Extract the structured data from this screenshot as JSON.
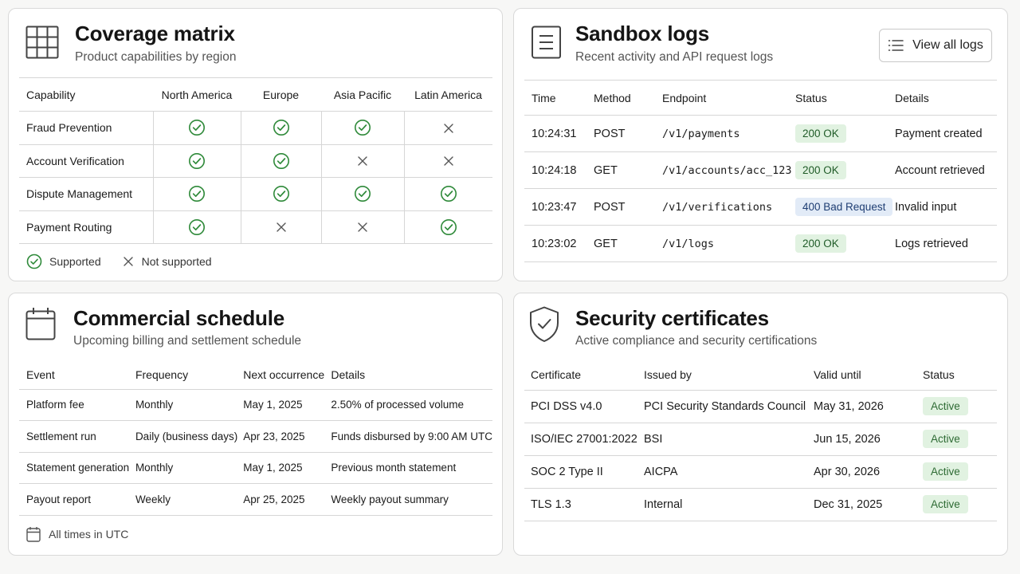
{
  "coverage": {
    "title": "Coverage matrix",
    "subtitle": "Product capabilities by region",
    "columns": [
      "Capability",
      "North America",
      "Europe",
      "Asia Pacific",
      "Latin America"
    ],
    "rows": [
      {
        "capability": "Fraud Prevention",
        "support": [
          true,
          true,
          true,
          false
        ]
      },
      {
        "capability": "Account Verification",
        "support": [
          true,
          true,
          false,
          false
        ]
      },
      {
        "capability": "Dispute Management",
        "support": [
          true,
          true,
          true,
          true
        ]
      },
      {
        "capability": "Payment Routing",
        "support": [
          true,
          false,
          false,
          true
        ]
      }
    ],
    "legend": {
      "supported": "Supported",
      "not_supported": "Not supported"
    }
  },
  "logs": {
    "title": "Sandbox logs",
    "subtitle": "Recent activity and API request logs",
    "view_all_label": "View all logs",
    "columns": [
      "Time",
      "Method",
      "Endpoint",
      "Status",
      "Details"
    ],
    "rows": [
      {
        "time": "10:24:31",
        "method": "POST",
        "endpoint": "/v1/payments",
        "status": "200 OK",
        "status_kind": "ok",
        "details": "Payment created"
      },
      {
        "time": "10:24:18",
        "method": "GET",
        "endpoint": "/v1/accounts/acc_123",
        "status": "200 OK",
        "status_kind": "ok",
        "details": "Account retrieved"
      },
      {
        "time": "10:23:47",
        "method": "POST",
        "endpoint": "/v1/verifications",
        "status": "400 Bad Request",
        "status_kind": "bad",
        "details": "Invalid input"
      },
      {
        "time": "10:23:02",
        "method": "GET",
        "endpoint": "/v1/logs",
        "status": "200 OK",
        "status_kind": "ok",
        "details": "Logs retrieved"
      }
    ]
  },
  "schedule": {
    "title": "Commercial schedule",
    "subtitle": "Upcoming billing and settlement schedule",
    "columns": [
      "Event",
      "Frequency",
      "Next occurrence",
      "Details"
    ],
    "rows": [
      {
        "event": "Platform fee",
        "frequency": "Monthly",
        "next": "May 1, 2025",
        "details": "2.50% of processed volume"
      },
      {
        "event": "Settlement run",
        "frequency": "Daily (business days)",
        "next": "Apr 23, 2025",
        "details": "Funds disbursed by 9:00 AM UTC"
      },
      {
        "event": "Statement generation",
        "frequency": "Monthly",
        "next": "May 1, 2025",
        "details": "Previous month statement"
      },
      {
        "event": "Payout report",
        "frequency": "Weekly",
        "next": "Apr 25, 2025",
        "details": "Weekly payout summary"
      }
    ],
    "footnote": "All times in UTC"
  },
  "security": {
    "title": "Security certificates",
    "subtitle": "Active compliance and security certifications",
    "columns": [
      "Certificate",
      "Issued by",
      "Valid until",
      "Status"
    ],
    "rows": [
      {
        "certificate": "PCI DSS v4.0",
        "issuer": "PCI Security Standards Council",
        "valid_until": "May 31, 2026",
        "status": "Active"
      },
      {
        "certificate": "ISO/IEC 27001:2022",
        "issuer": "BSI",
        "valid_until": "Jun 15, 2026",
        "status": "Active"
      },
      {
        "certificate": "SOC 2 Type II",
        "issuer": "AICPA",
        "valid_until": "Apr 30, 2026",
        "status": "Active"
      },
      {
        "certificate": "TLS 1.3",
        "issuer": "Internal",
        "valid_until": "Dec 31, 2025",
        "status": "Active"
      }
    ]
  },
  "colors": {
    "check_green": "#2f8a3a",
    "cross_gray": "#555555",
    "badge_ok_bg": "#e1f2e1",
    "badge_bad_bg": "#e2ebf7"
  },
  "icons": {
    "coverage": "grid-icon",
    "logs": "document-icon",
    "schedule": "calendar-icon",
    "security": "shield-check-icon",
    "view_all": "list-icon",
    "supported": "check-circle-icon",
    "not_supported": "cross-icon"
  }
}
